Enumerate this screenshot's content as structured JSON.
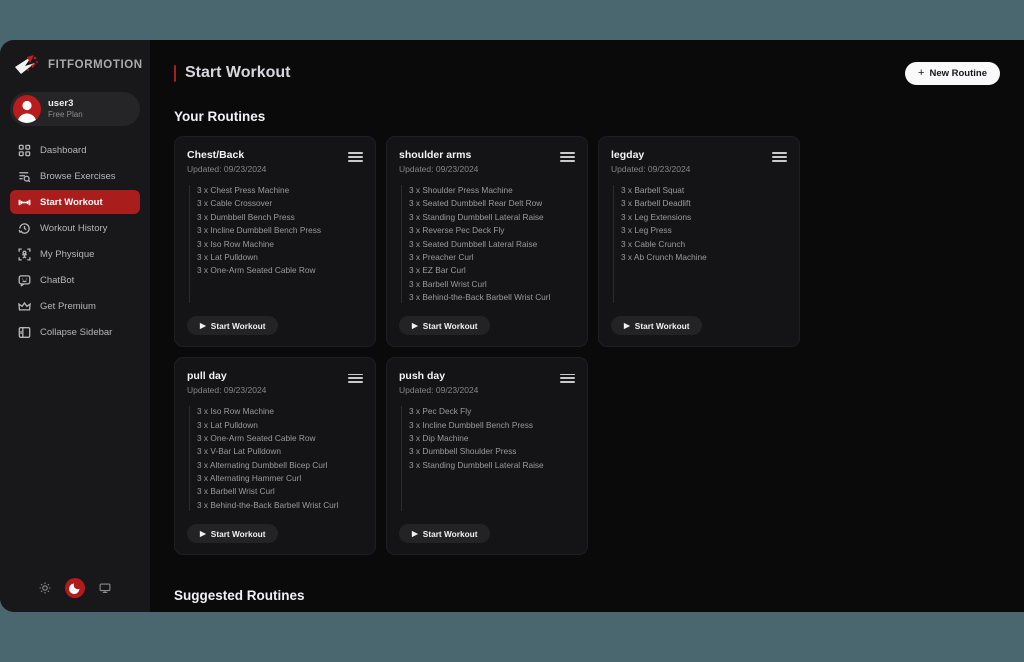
{
  "theme": {
    "page_background": "#4a666f",
    "app_background": "#0a0a0b",
    "sidebar_background": "#18181a",
    "accent": "#a91d1d",
    "card_background": "#141416"
  },
  "sidebar": {
    "brand": {
      "name": "FITFORMOTION",
      "logo_icon": "fitformotion-logo-icon"
    },
    "user": {
      "name": "user3",
      "plan": "Free Plan",
      "avatar_icon": "user-avatar-icon"
    },
    "items": [
      {
        "label": "Dashboard",
        "icon": "grid-dashboard-icon",
        "active": false
      },
      {
        "label": "Browse Exercises",
        "icon": "list-search-icon",
        "active": false
      },
      {
        "label": "Start Workout",
        "icon": "dumbbell-icon",
        "active": true
      },
      {
        "label": "Workout History",
        "icon": "clock-history-icon",
        "active": false
      },
      {
        "label": "My Physique",
        "icon": "body-scan-icon",
        "active": false
      },
      {
        "label": "ChatBot",
        "icon": "chat-bubble-icon",
        "active": false
      },
      {
        "label": "Get Premium",
        "icon": "crown-icon",
        "active": false
      },
      {
        "label": "Collapse Sidebar",
        "icon": "panel-collapse-icon",
        "active": false
      }
    ],
    "theme_switch": [
      {
        "name": "light-theme-button",
        "icon": "sun-icon",
        "active": false
      },
      {
        "name": "dark-theme-button",
        "icon": "moon-icon",
        "active": true
      },
      {
        "name": "system-theme-button",
        "icon": "monitor-icon",
        "active": false
      }
    ]
  },
  "header": {
    "page_title": "Start Workout",
    "new_routine_label": "New Routine",
    "new_routine_icon": "plus-icon"
  },
  "sections": {
    "your_routines_title": "Your Routines",
    "suggested_routines_title": "Suggested Routines"
  },
  "card_common": {
    "start_label": "Start Workout",
    "start_icon": "play-icon",
    "menu_icon": "hamburger-menu-icon"
  },
  "routines": [
    {
      "title": "Chest/Back",
      "updated": "Updated: 09/23/2024",
      "exercises": [
        "3 x Chest Press Machine",
        "3 x Cable Crossover",
        "3 x Dumbbell Bench Press",
        "3 x Incline Dumbbell Bench Press",
        "3 x Iso Row Machine",
        "3 x Lat Pulldown",
        "3 x One-Arm Seated Cable Row"
      ]
    },
    {
      "title": "shoulder arms",
      "updated": "Updated: 09/23/2024",
      "exercises": [
        "3 x Shoulder Press Machine",
        "3 x Seated Dumbbell Rear Delt Row",
        "3 x Standing Dumbbell Lateral Raise",
        "3 x Reverse Pec Deck Fly",
        "3 x Seated Dumbbell Lateral Raise",
        "3 x Preacher Curl",
        "3 x EZ Bar Curl",
        "3 x Barbell Wrist Curl",
        "3 x Behind-the-Back Barbell Wrist Curl"
      ]
    },
    {
      "title": "legday",
      "updated": "Updated: 09/23/2024",
      "exercises": [
        "3 x Barbell Squat",
        "3 x Barbell Deadlift",
        "3 x Leg Extensions",
        "3 x Leg Press",
        "3 x Cable Crunch",
        "3 x Ab Crunch Machine"
      ]
    },
    {
      "title": "pull day",
      "updated": "Updated: 09/23/2024",
      "exercises": [
        "3 x Iso Row Machine",
        "3 x Lat Pulldown",
        "3 x One-Arm Seated Cable Row",
        "3 x V-Bar Lat Pulldown",
        "3 x Alternating Dumbbell Bicep Curl",
        "3 x Alternating Hammer Curl",
        "3 x Barbell Wrist Curl",
        "3 x Behind-the-Back Barbell Wrist Curl"
      ]
    },
    {
      "title": "push day",
      "updated": "Updated: 09/23/2024",
      "exercises": [
        "3 x Pec Deck Fly",
        "3 x Incline Dumbbell Bench Press",
        "3 x Dip Machine",
        "3 x Dumbbell Shoulder Press",
        "3 x Standing Dumbbell Lateral Raise"
      ]
    }
  ]
}
